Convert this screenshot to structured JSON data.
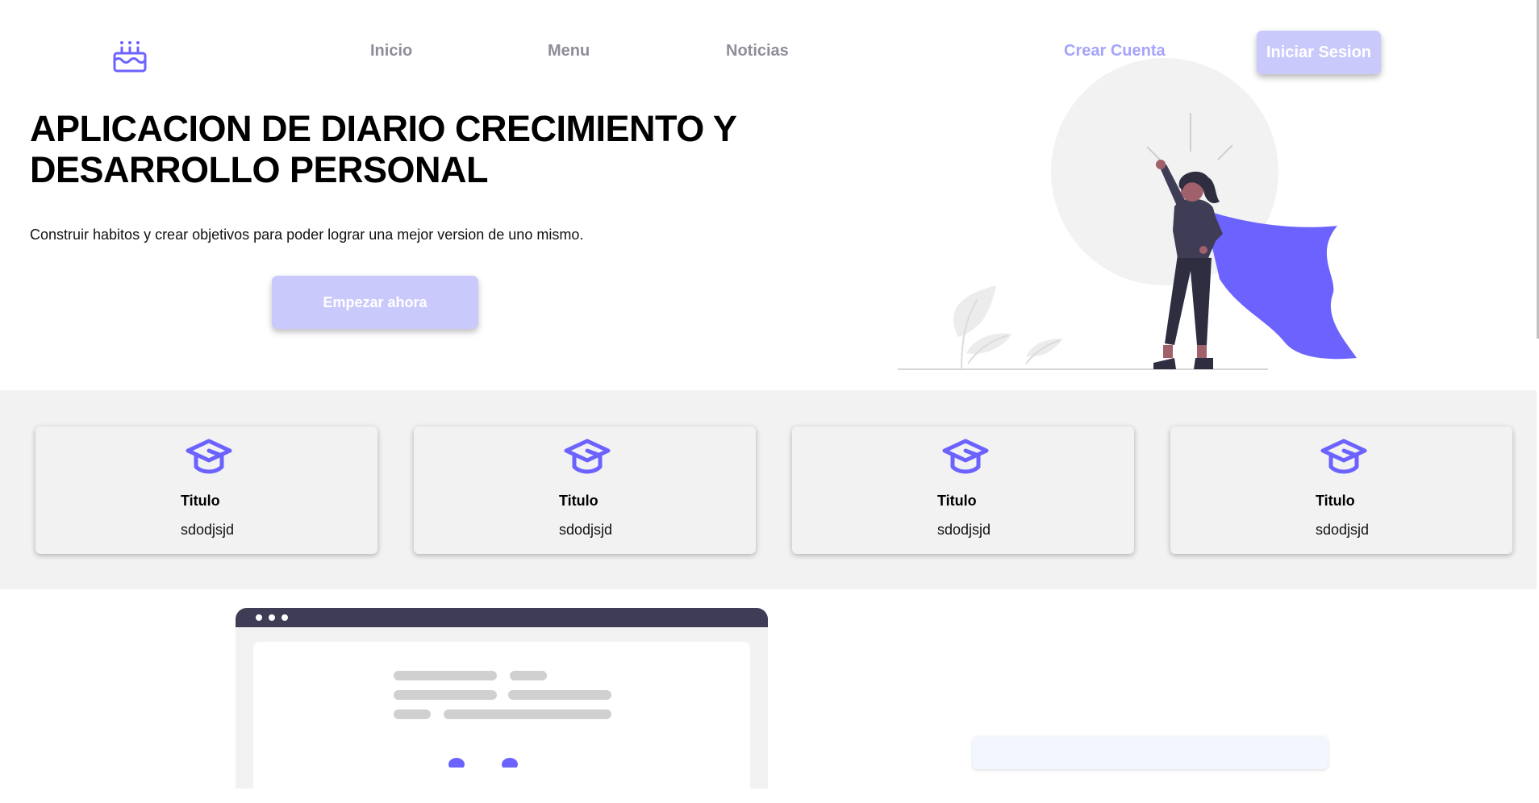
{
  "header": {
    "logo_icon": "cake-icon",
    "nav": [
      {
        "label": "Inicio"
      },
      {
        "label": "Menu"
      },
      {
        "label": "Noticias"
      }
    ],
    "signup_label": "Crear Cuenta",
    "login_label": "Iniciar Sesion"
  },
  "hero": {
    "title": "APLICACION DE DIARIO CRECIMIENTO Y DESARROLLO PERSONAL",
    "subtitle": "Construir habitos y crear objetivos para poder lograr una mejor version de uno mismo.",
    "cta_label": "Empezar ahora",
    "illustration": "superhero-woman-illustration"
  },
  "features": {
    "cards": [
      {
        "icon": "graduation-cap-icon",
        "title": "Titulo",
        "text": "sdodjsjd"
      },
      {
        "icon": "graduation-cap-icon",
        "title": "Titulo",
        "text": "sdodjsjd"
      },
      {
        "icon": "graduation-cap-icon",
        "title": "Titulo",
        "text": "sdodjsjd"
      },
      {
        "icon": "graduation-cap-icon",
        "title": "Titulo",
        "text": "sdodjsjd"
      }
    ]
  },
  "colors": {
    "accent": "#6c63ff",
    "button_bg": "#cac9fc",
    "link_accent": "#a5a3fb",
    "nav_text": "#8e8d98",
    "section_bg": "#f2f2f2",
    "dark": "#3f3d56"
  }
}
